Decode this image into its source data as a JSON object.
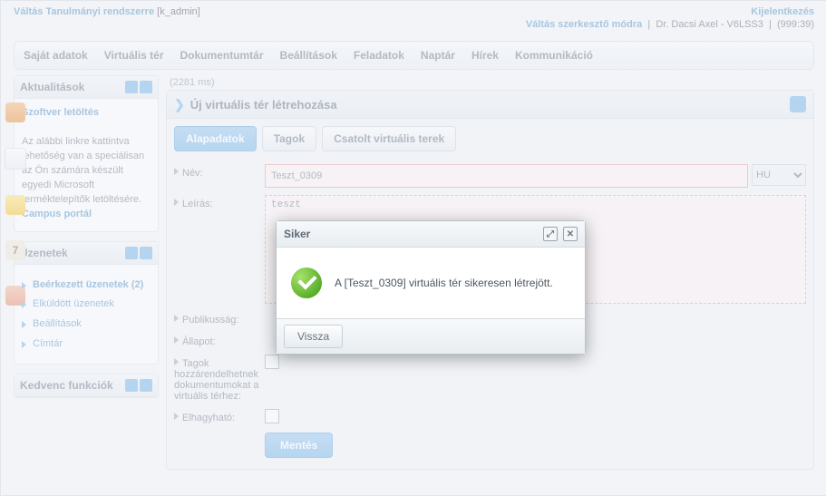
{
  "top": {
    "switch_system": "Váltás Tanulmányi rendszerre",
    "account_tag": "[k_admin]",
    "logout": "Kijelentkezés"
  },
  "userline": {
    "switch_edit": "Váltás szerkesztő módra",
    "user_name": "Dr. Dacsi Axel - V6LSS3",
    "timer": "(999:39)"
  },
  "menu": {
    "items": [
      "Saját adatok",
      "Virtuális tér",
      "Dokumentumtár",
      "Beállítások",
      "Feladatok",
      "Naptár",
      "Hírek",
      "Kommunikáció"
    ]
  },
  "sideicons": {
    "calendar_day": "7"
  },
  "panels": {
    "news": {
      "title": "Aktualitások",
      "link1": "Szoftver letöltés",
      "body": "Az alábbi linkre kattintva lehetőség van a speciálisan az Ön számára készült egyedi Microsoft terméktelepítők letöltésére.",
      "link2": "Campus portál"
    },
    "messages": {
      "title": "Üzenetek",
      "items": [
        "Beérkezett üzenetek (2)",
        "Elküldött üzenetek",
        "Beállítások",
        "Címtár"
      ]
    },
    "fav": {
      "title": "Kedvenc funkciók"
    }
  },
  "main": {
    "timing": "(2281 ms)",
    "heading": "Új virtuális tér létrehozása",
    "tabs": [
      "Alapadatok",
      "Tagok",
      "Csatolt virtuális terek"
    ],
    "active_tab": 0,
    "labels": {
      "name": "Név:",
      "desc": "Leírás:",
      "public": "Publikusság:",
      "state": "Állapot:",
      "members": "Tagok hozzárendelhetnek dokumentumokat a virtuális térhez:",
      "leavable": "Elhagyható:"
    },
    "name_value": "Teszt_0309",
    "lang_value": "HU",
    "desc_value": "teszt",
    "save": "Mentés"
  },
  "modal": {
    "title": "Siker",
    "message": "A [Teszt_0309] virtuális tér sikeresen létrejött.",
    "back": "Vissza"
  }
}
